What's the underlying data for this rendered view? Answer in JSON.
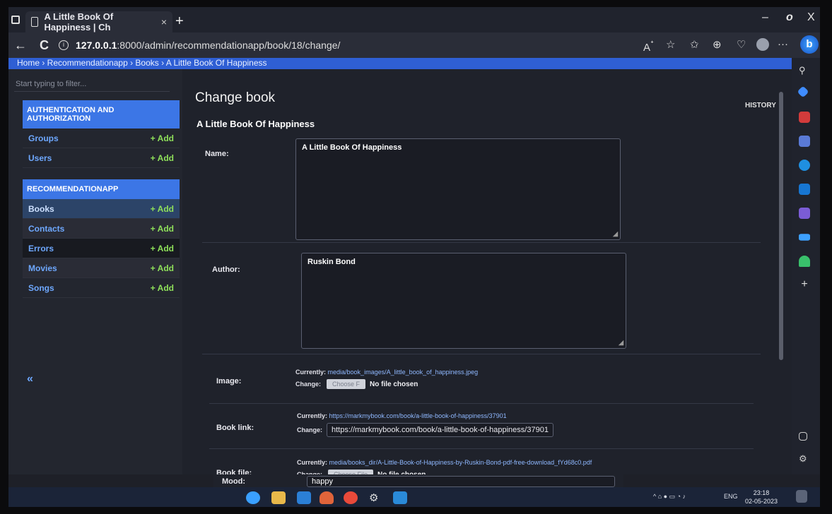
{
  "browser": {
    "tab_title": "A Little Book Of Happiness | Ch",
    "tab_close": "×",
    "new_tab": "+",
    "url_host": "127.0.0.1",
    "url_rest": ":8000/admin/recommendationapp/book/18/change/",
    "back": "←",
    "reload": "C",
    "info": "i",
    "more": "···",
    "win_min": "–",
    "win_max": "o",
    "win_close": "X",
    "bing": "b"
  },
  "breadcrumb": "Home › Recommendationapp › Books › A Little Book Of Happiness",
  "sidebar": {
    "filter_placeholder": "Start typing to filter...",
    "auth_caption": "AUTHENTICATION AND AUTHORIZATION",
    "auth_models": [
      {
        "name": "Groups",
        "add": "+ Add"
      },
      {
        "name": "Users",
        "add": "+ Add"
      }
    ],
    "app_caption": "RECOMMENDATIONAPP",
    "app_models": [
      {
        "name": "Books",
        "add": "+ Add"
      },
      {
        "name": "Contacts",
        "add": "+ Add"
      },
      {
        "name": "Errors",
        "add": "+ Add"
      },
      {
        "name": "Movies",
        "add": "+ Add"
      },
      {
        "name": "Songs",
        "add": "+ Add"
      }
    ],
    "collapse": "«"
  },
  "content": {
    "page_title": "Change book",
    "history": "HISTORY",
    "object_title": "A Little Book Of Happiness",
    "name_label": "Name:",
    "name_value": "A Little Book Of Happiness",
    "author_label": "Author:",
    "author_value": "Ruskin Bond",
    "image_label": "Image:",
    "image_currently_label": "Currently:",
    "image_currently": "media/book_images/A_little_book_of_happiness.jpeg",
    "image_change_label": "Change:",
    "image_choose": "Choose F",
    "image_nofile": "No file chosen",
    "link_label": "Book link:",
    "link_currently_label": "Currently:",
    "link_currently": "https://markmybook.com/book/a-little-book-of-happiness/37901",
    "link_change_label": "Change:",
    "link_value": "https://markmybook.com/book/a-little-book-of-happiness/37901",
    "file_label": "Book file:",
    "file_currently_label": "Currently:",
    "file_currently": "media/books_dir/A-Little-Book-of-Happiness-by-Ruskin-Bond-pdf-free-download_fYd68c0.pdf",
    "file_change_label": "Change:",
    "file_choose": "Choose File",
    "file_nofile": "No file chosen",
    "mood_label": "Mood:",
    "mood_value": "happy"
  },
  "tray": {
    "lang": "ENG",
    "time": "23:18",
    "date": "02-05-2023"
  },
  "colors": {
    "accent": "#3c76e6",
    "add_green": "#8fe05a",
    "link_blue": "#6ea8ff"
  }
}
